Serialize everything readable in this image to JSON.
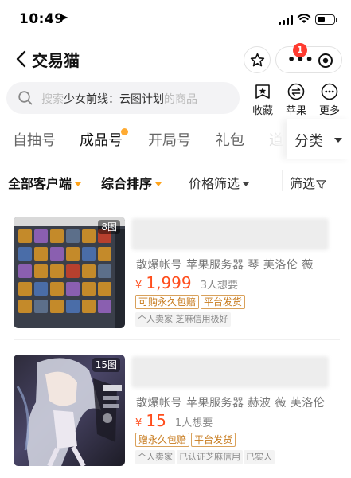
{
  "status_bar": {
    "time": "10:49"
  },
  "header": {
    "title": "交易猫",
    "badge_count": "1"
  },
  "search": {
    "prefix": "搜索",
    "highlight": "少女前线：云图计划",
    "suffix": "的商品"
  },
  "quick_actions": [
    {
      "label": "收藏",
      "icon": "star-box-icon"
    },
    {
      "label": "苹果",
      "icon": "swap-icon"
    },
    {
      "label": "更多",
      "icon": "more-icon"
    }
  ],
  "tabs": [
    "自抽号",
    "成品号",
    "开局号",
    "礼包",
    "道"
  ],
  "category_label": "分类",
  "filters": {
    "client": "全部客户端",
    "sort": "综合排序",
    "price": "价格筛选",
    "filter": "筛选"
  },
  "listings": [
    {
      "image_count": "8图",
      "tags": "散爆帐号  苹果服务器  琴  芙洛伦  薇",
      "currency": "¥",
      "price": "1,999",
      "want": "3人想要",
      "badges": [
        "可购永久包赔",
        "平台发货"
      ],
      "seller_tags": [
        "个人卖家 芝麻信用极好"
      ]
    },
    {
      "image_count": "15图",
      "tags": "散爆帐号  苹果服务器  赫波  薇  芙洛伦",
      "currency": "¥",
      "price": "15",
      "want": "1人想要",
      "badges": [
        "赠永久包赔",
        "平台发货"
      ],
      "seller_tags": [
        "个人卖家",
        "已认证芝麻信用",
        "已实人"
      ]
    }
  ],
  "colors": {
    "price": "#ff4d1c",
    "accent": "#ffa31a",
    "badge": "#ff3b30"
  }
}
